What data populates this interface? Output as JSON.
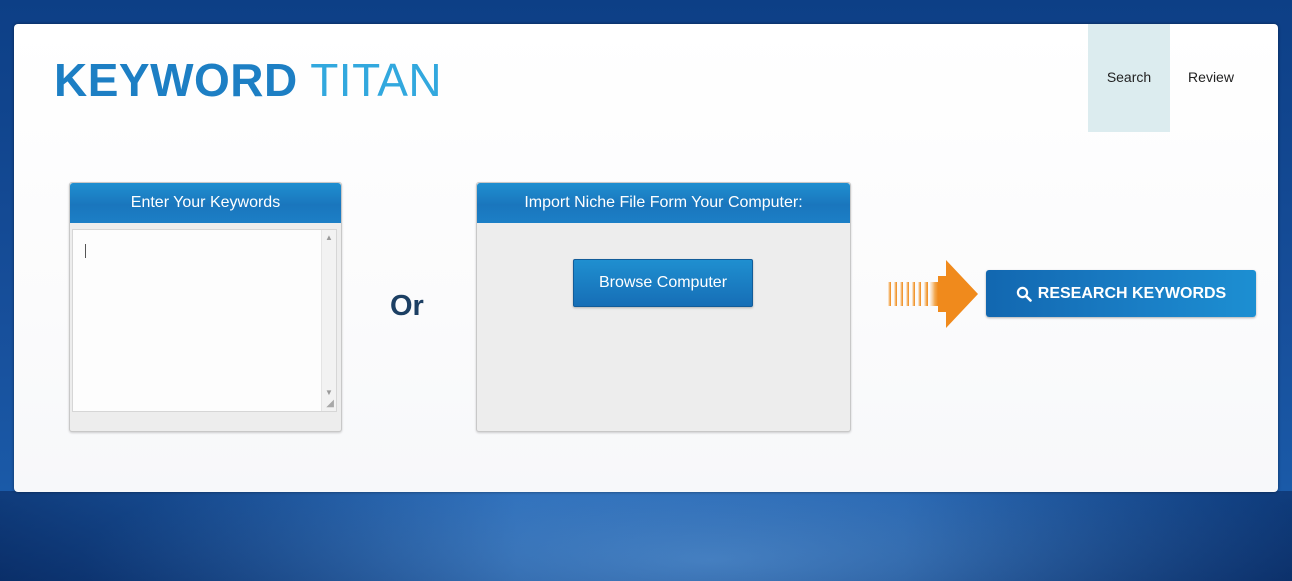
{
  "logo": {
    "bold": "KEYWORD",
    "light": "TITAN"
  },
  "nav": {
    "items": [
      {
        "label": "Search",
        "active": true
      },
      {
        "label": "Review",
        "active": false
      }
    ]
  },
  "keywords_panel": {
    "header": "Enter Your Keywords",
    "value": ""
  },
  "separator": "Or",
  "import_panel": {
    "header": "Import Niche File Form Your Computer:",
    "browse_label": "Browse Computer"
  },
  "arrow_icon": "orange-right-arrow",
  "research_button": {
    "icon": "search-icon",
    "label": "RESEARCH KEYWORDS"
  },
  "colors": {
    "accent": "#1a7fc4",
    "accent_light": "#32a8de",
    "arrow": "#f08a1c",
    "desktop_bg": "#174f9b"
  }
}
